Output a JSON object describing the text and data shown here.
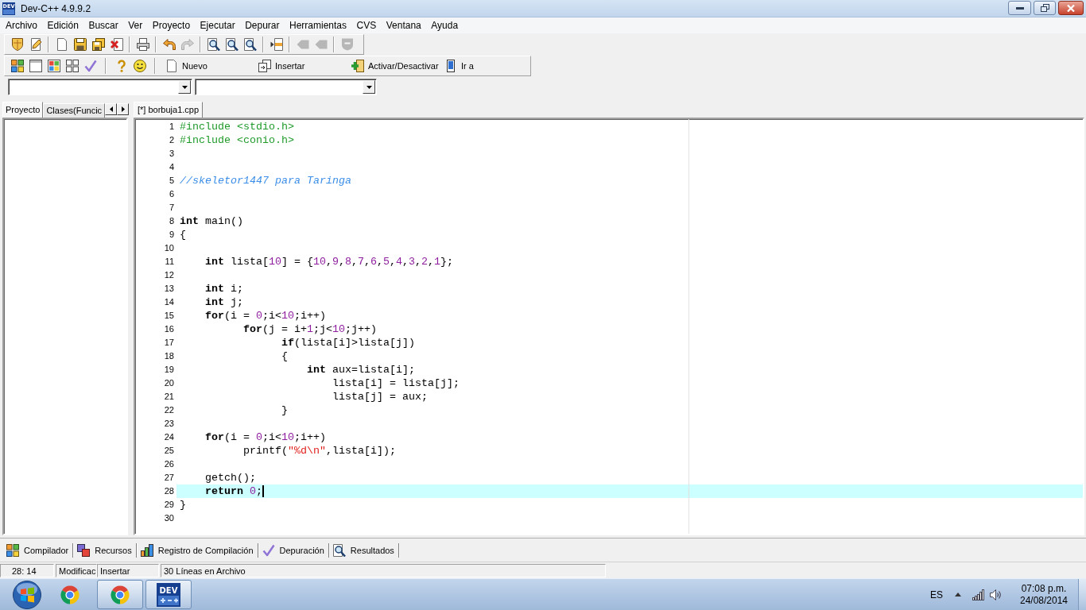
{
  "window": {
    "icon_text": "DEV",
    "title": "Dev-C++ 4.9.9.2"
  },
  "menu": [
    "Archivo",
    "Edición",
    "Buscar",
    "Ver",
    "Proyecto",
    "Ejecutar",
    "Depurar",
    "Herramientas",
    "CVS",
    "Ventana",
    "Ayuda"
  ],
  "main_toolbar": {
    "groups": [
      {
        "buttons": [
          {
            "disabled": false
          },
          {
            "disabled": false
          }
        ]
      },
      {
        "buttons": [
          {
            "disabled": false
          },
          {
            "disabled": false
          },
          {
            "disabled": false
          },
          {
            "disabled": false
          }
        ]
      },
      {
        "buttons": [
          {
            "disabled": false
          }
        ]
      },
      {
        "buttons": [
          {
            "disabled": false
          },
          {
            "disabled": true
          }
        ]
      },
      {
        "buttons": [
          {
            "disabled": false
          },
          {
            "disabled": false
          },
          {
            "disabled": false
          }
        ]
      },
      {
        "buttons": [
          {
            "disabled": false
          }
        ]
      },
      {
        "buttons": [
          {
            "disabled": true
          },
          {
            "disabled": true
          }
        ]
      },
      {
        "buttons": [
          {
            "disabled": true
          }
        ]
      }
    ]
  },
  "secondary_toolbar": {
    "groups": [
      {
        "buttons": [
          {
            "disabled": false
          },
          {
            "disabled": false
          },
          {
            "disabled": false
          },
          {
            "disabled": false
          },
          {
            "disabled": false
          }
        ]
      },
      {
        "buttons": [
          {
            "disabled": false
          },
          {
            "disabled": false
          }
        ]
      }
    ],
    "actions": [
      {
        "label": "Nuevo"
      },
      {
        "label": "Insertar"
      },
      {
        "label": "Activar/Desactivar"
      },
      {
        "label": "Ir a"
      }
    ]
  },
  "project_panel": {
    "tabs": [
      {
        "label": "Proyecto",
        "selected": true
      },
      {
        "label": "Clases(Funcic",
        "selected": false
      }
    ]
  },
  "editor": {
    "tabs": [
      {
        "label": "[*] borbuja1.cpp",
        "selected": true
      }
    ],
    "lines": [
      {
        "number": "1",
        "current": false,
        "tokens": [
          {
            "kind": "directive",
            "text": "#include <stdio.h>"
          }
        ]
      },
      {
        "number": "2",
        "current": false,
        "tokens": [
          {
            "kind": "directive",
            "text": "#include <conio.h>"
          }
        ]
      },
      {
        "number": "3",
        "current": false
      },
      {
        "number": "4",
        "current": false
      },
      {
        "number": "5",
        "current": false,
        "tokens": [
          {
            "kind": "comment",
            "text": "//skeletor1447 para Taringa"
          }
        ]
      },
      {
        "number": "6",
        "current": false
      },
      {
        "number": "7",
        "current": false
      },
      {
        "number": "8",
        "current": false,
        "tokens": [
          {
            "kind": "keyword",
            "text": "int"
          },
          {
            "kind": "plain",
            "text": " main()"
          }
        ]
      },
      {
        "number": "9",
        "current": false,
        "tokens": [
          {
            "kind": "plain",
            "text": "{"
          }
        ]
      },
      {
        "number": "10",
        "current": false
      },
      {
        "number": "11",
        "current": false,
        "tokens": [
          {
            "kind": "keyword",
            "text": "    int"
          },
          {
            "kind": "plain",
            "text": " lista["
          },
          {
            "kind": "number",
            "text": "10"
          },
          {
            "kind": "plain",
            "text": "] = {"
          },
          {
            "kind": "number",
            "text": "10"
          },
          {
            "kind": "plain",
            "text": ","
          },
          {
            "kind": "number",
            "text": "9"
          },
          {
            "kind": "plain",
            "text": ","
          },
          {
            "kind": "number",
            "text": "8"
          },
          {
            "kind": "plain",
            "text": ","
          },
          {
            "kind": "number",
            "text": "7"
          },
          {
            "kind": "plain",
            "text": ","
          },
          {
            "kind": "number",
            "text": "6"
          },
          {
            "kind": "plain",
            "text": ","
          },
          {
            "kind": "number",
            "text": "5"
          },
          {
            "kind": "plain",
            "text": ","
          },
          {
            "kind": "number",
            "text": "4"
          },
          {
            "kind": "plain",
            "text": ","
          },
          {
            "kind": "number",
            "text": "3"
          },
          {
            "kind": "plain",
            "text": ","
          },
          {
            "kind": "number",
            "text": "2"
          },
          {
            "kind": "plain",
            "text": ","
          },
          {
            "kind": "number",
            "text": "1"
          },
          {
            "kind": "plain",
            "text": "};"
          }
        ]
      },
      {
        "number": "12",
        "current": false
      },
      {
        "number": "13",
        "current": false,
        "tokens": [
          {
            "kind": "keyword",
            "text": "    int"
          },
          {
            "kind": "plain",
            "text": " i;"
          }
        ]
      },
      {
        "number": "14",
        "current": false,
        "tokens": [
          {
            "kind": "keyword",
            "text": "    int"
          },
          {
            "kind": "plain",
            "text": " j;"
          }
        ]
      },
      {
        "number": "15",
        "current": false,
        "tokens": [
          {
            "kind": "keyword",
            "text": "    for"
          },
          {
            "kind": "plain",
            "text": "(i = "
          },
          {
            "kind": "number",
            "text": "0"
          },
          {
            "kind": "plain",
            "text": ";i<"
          },
          {
            "kind": "number",
            "text": "10"
          },
          {
            "kind": "plain",
            "text": ";i++)"
          }
        ]
      },
      {
        "number": "16",
        "current": false,
        "tokens": [
          {
            "kind": "keyword",
            "text": "          for"
          },
          {
            "kind": "plain",
            "text": "(j = i+"
          },
          {
            "kind": "number",
            "text": "1"
          },
          {
            "kind": "plain",
            "text": ";j<"
          },
          {
            "kind": "number",
            "text": "10"
          },
          {
            "kind": "plain",
            "text": ";j++)"
          }
        ]
      },
      {
        "number": "17",
        "current": false,
        "tokens": [
          {
            "kind": "keyword",
            "text": "                if"
          },
          {
            "kind": "plain",
            "text": "(lista[i]>lista[j])"
          }
        ]
      },
      {
        "number": "18",
        "current": false,
        "tokens": [
          {
            "kind": "plain",
            "text": "                {"
          }
        ]
      },
      {
        "number": "19",
        "current": false,
        "tokens": [
          {
            "kind": "keyword",
            "text": "                    int"
          },
          {
            "kind": "plain",
            "text": " aux=lista[i];"
          }
        ]
      },
      {
        "number": "20",
        "current": false,
        "tokens": [
          {
            "kind": "plain",
            "text": "                        lista[i] = lista[j];"
          }
        ]
      },
      {
        "number": "21",
        "current": false,
        "tokens": [
          {
            "kind": "plain",
            "text": "                        lista[j] = aux;"
          }
        ]
      },
      {
        "number": "22",
        "current": false,
        "tokens": [
          {
            "kind": "plain",
            "text": "                }"
          }
        ]
      },
      {
        "number": "23",
        "current": false
      },
      {
        "number": "24",
        "current": false,
        "tokens": [
          {
            "kind": "keyword",
            "text": "    for"
          },
          {
            "kind": "plain",
            "text": "(i = "
          },
          {
            "kind": "number",
            "text": "0"
          },
          {
            "kind": "plain",
            "text": ";i<"
          },
          {
            "kind": "number",
            "text": "10"
          },
          {
            "kind": "plain",
            "text": ";i++)"
          }
        ]
      },
      {
        "number": "25",
        "current": false,
        "tokens": [
          {
            "kind": "plain",
            "text": "          printf("
          },
          {
            "kind": "string",
            "text": "\"%d\\n\""
          },
          {
            "kind": "plain",
            "text": ",lista[i]);"
          }
        ]
      },
      {
        "number": "26",
        "current": false
      },
      {
        "number": "27",
        "current": false,
        "tokens": [
          {
            "kind": "plain",
            "text": "    getch();"
          }
        ]
      },
      {
        "number": "28",
        "current": true,
        "tokens": [
          {
            "kind": "keyword",
            "text": "    return"
          },
          {
            "kind": "number",
            "text": " 0"
          },
          {
            "kind": "plain",
            "text": ";"
          }
        ]
      },
      {
        "number": "29",
        "current": false,
        "tokens": [
          {
            "kind": "plain",
            "text": "}"
          }
        ]
      },
      {
        "number": "30",
        "current": false
      }
    ]
  },
  "output_tabs": [
    "Compilador",
    "Recursos",
    "Registro de Compilación",
    "Depuración",
    "Resultados"
  ],
  "status_bar": {
    "cursor": "28: 14",
    "modified": "Modificac",
    "mode": "Insertar",
    "info": "30 Líneas en Archivo"
  },
  "taskbar": {
    "apps": [
      {
        "kind": "browser",
        "running": false
      },
      {
        "kind": "browser",
        "running": true
      },
      {
        "kind": "ide",
        "running": true,
        "logo_text": "DEV"
      }
    ],
    "language": "ES",
    "time": "07:08 p.m.",
    "date": "24/08/2014"
  }
}
